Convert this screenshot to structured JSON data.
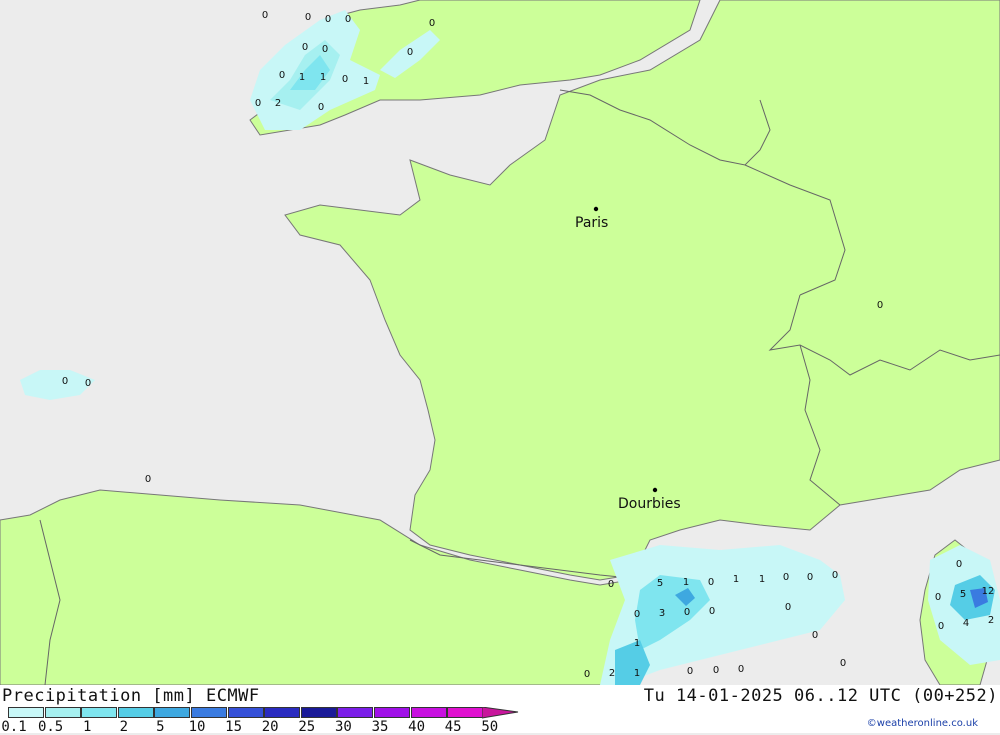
{
  "map": {
    "cities": [
      {
        "name": "Paris"
      },
      {
        "name": "Dourbies"
      }
    ],
    "precip_values": [
      "0",
      "0",
      "0",
      "0",
      "0",
      "0",
      "0",
      "0",
      "1",
      "1",
      "0",
      "1",
      "0",
      "2",
      "0",
      "0",
      "0",
      "0",
      "0",
      "0",
      "5",
      "1",
      "0",
      "1",
      "1",
      "0",
      "0",
      "0",
      "0",
      "3",
      "0",
      "0",
      "0",
      "1",
      "0",
      "2",
      "1",
      "0",
      "0",
      "0",
      "0",
      "0",
      "0",
      "5",
      "12",
      "0",
      "4",
      "2",
      "0",
      "0"
    ]
  },
  "legend": {
    "title": "Precipitation [mm] ECMWF",
    "time": "Tu 14-01-2025 06..12 UTC (00+252)",
    "credit": "©weatheronline.co.uk",
    "scale": [
      {
        "label": "0.1",
        "color": "#c8f7f7"
      },
      {
        "label": "0.5",
        "color": "#a6f0f0"
      },
      {
        "label": "1",
        "color": "#7fe5ef"
      },
      {
        "label": "2",
        "color": "#55cde6"
      },
      {
        "label": "5",
        "color": "#3ea8e0"
      },
      {
        "label": "10",
        "color": "#3a7be0"
      },
      {
        "label": "15",
        "color": "#3550d8"
      },
      {
        "label": "20",
        "color": "#2a2bc0"
      },
      {
        "label": "25",
        "color": "#1a1a98"
      },
      {
        "label": "30",
        "color": "#7b1ee8"
      },
      {
        "label": "35",
        "color": "#a010e8"
      },
      {
        "label": "40",
        "color": "#c810e0"
      },
      {
        "label": "45",
        "color": "#e010d0"
      },
      {
        "label": "50",
        "color": "#c8169c"
      }
    ]
  },
  "colors": {
    "land": "#ccff99",
    "sea": "#ececec",
    "border": "#666666"
  }
}
